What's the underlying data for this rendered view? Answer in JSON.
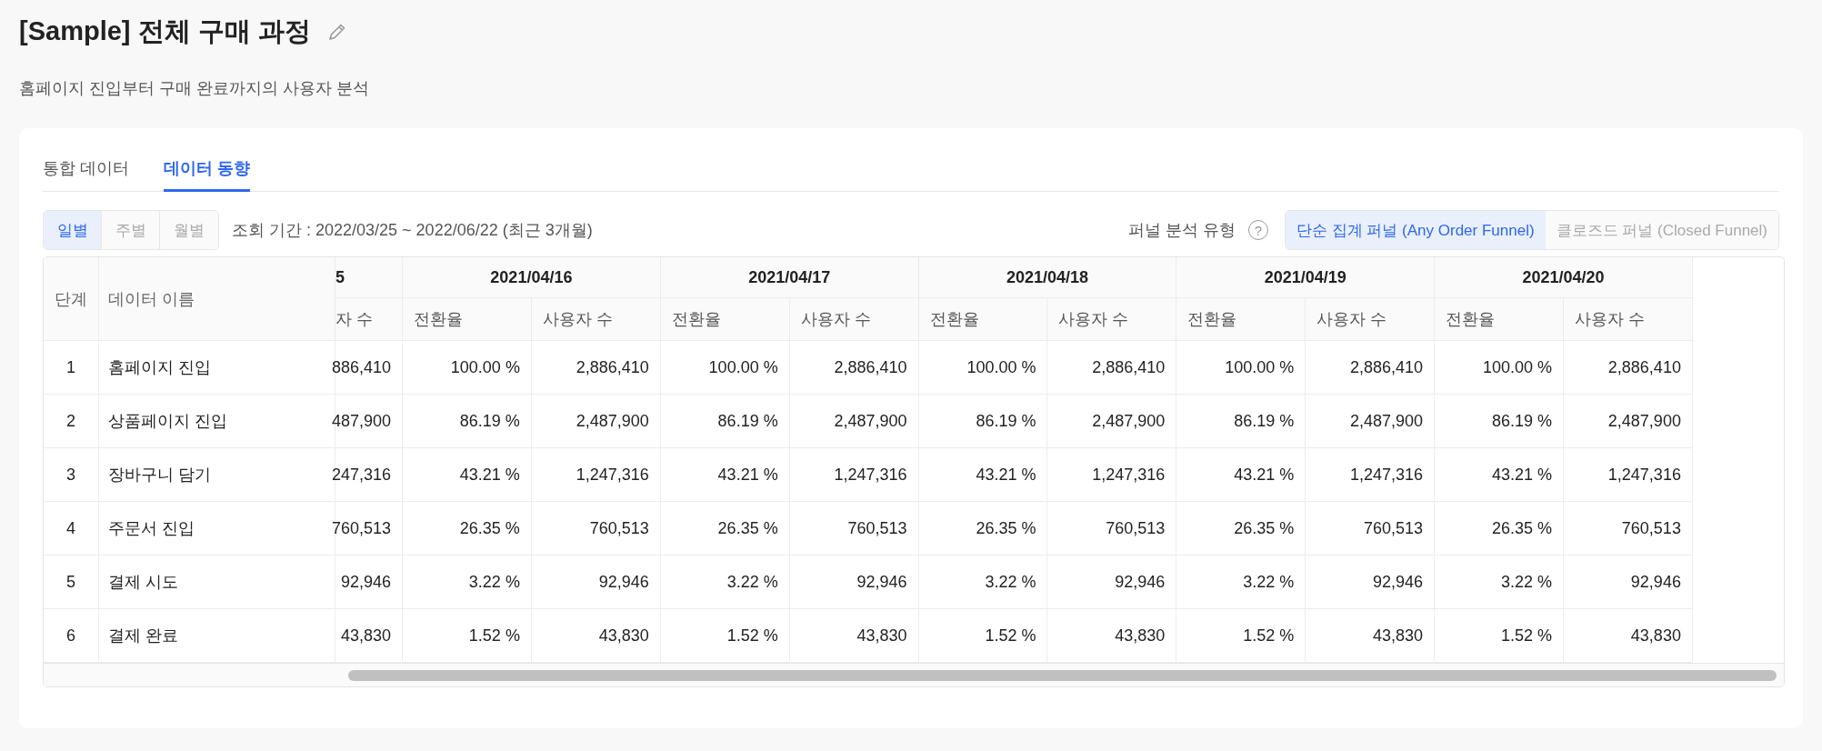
{
  "title": "[Sample] 전체 구매 과정",
  "subtitle": "홈페이지 진입부터 구매 완료까지의 사용자 분석",
  "tabs": [
    {
      "label": "통합 데이터",
      "selected": false
    },
    {
      "label": "데이터 동향",
      "selected": true
    }
  ],
  "period_buttons": [
    {
      "label": "일별",
      "selected": true
    },
    {
      "label": "주별",
      "selected": false
    },
    {
      "label": "월별",
      "selected": false
    }
  ],
  "period_text": "조회 기간 : 2022/03/25 ~ 2022/06/22 (최근 3개월)",
  "funnel_type": {
    "label": "퍼널 분석 유형",
    "help": "?",
    "options": [
      {
        "label": "단순 집계 퍼널 (Any Order Funnel)",
        "selected": true
      },
      {
        "label": "클로즈드 퍼널 (Closed Funnel)",
        "selected": false
      }
    ]
  },
  "table": {
    "columns": [
      "단계",
      "데이터 이름"
    ],
    "partial_date": "5",
    "partial_column": "자 수",
    "dates": [
      {
        "date": "2021/04/16",
        "columns": [
          "전환율",
          "사용자 수"
        ]
      },
      {
        "date": "2021/04/17",
        "columns": [
          "전환율",
          "사용자 수"
        ]
      },
      {
        "date": "2021/04/18",
        "columns": [
          "전환율",
          "사용자 수"
        ]
      },
      {
        "date": "2021/04/19",
        "columns": [
          "전환율",
          "사용자 수"
        ]
      },
      {
        "date": "2021/04/20",
        "columns": [
          "전환율",
          "사용자 수"
        ]
      }
    ],
    "rows": [
      {
        "step": "1",
        "name": "홈페이지 진입",
        "values": [
          "886,410",
          "100.00 %",
          "2,886,410",
          "100.00 %",
          "2,886,410",
          "100.00 %",
          "2,886,410",
          "100.00 %",
          "2,886,410",
          "100.00 %",
          "2,886,410"
        ]
      },
      {
        "step": "2",
        "name": "상품페이지 진입",
        "values": [
          "487,900",
          "86.19 %",
          "2,487,900",
          "86.19 %",
          "2,487,900",
          "86.19 %",
          "2,487,900",
          "86.19 %",
          "2,487,900",
          "86.19 %",
          "2,487,900"
        ]
      },
      {
        "step": "3",
        "name": "장바구니 담기",
        "values": [
          "247,316",
          "43.21 %",
          "1,247,316",
          "43.21 %",
          "1,247,316",
          "43.21 %",
          "1,247,316",
          "43.21 %",
          "1,247,316",
          "43.21 %",
          "1,247,316"
        ]
      },
      {
        "step": "4",
        "name": "주문서 진입",
        "values": [
          "760,513",
          "26.35 %",
          "760,513",
          "26.35 %",
          "760,513",
          "26.35 %",
          "760,513",
          "26.35 %",
          "760,513",
          "26.35 %",
          "760,513"
        ]
      },
      {
        "step": "5",
        "name": "결제 시도",
        "values": [
          "92,946",
          "3.22 %",
          "92,946",
          "3.22 %",
          "92,946",
          "3.22 %",
          "92,946",
          "3.22 %",
          "92,946",
          "3.22 %",
          "92,946"
        ]
      },
      {
        "step": "6",
        "name": "결제 완료",
        "values": [
          "43,830",
          "1.52 %",
          "43,830",
          "1.52 %",
          "43,830",
          "1.52 %",
          "43,830",
          "1.52 %",
          "43,830",
          "1.52 %",
          "43,830"
        ]
      }
    ]
  }
}
